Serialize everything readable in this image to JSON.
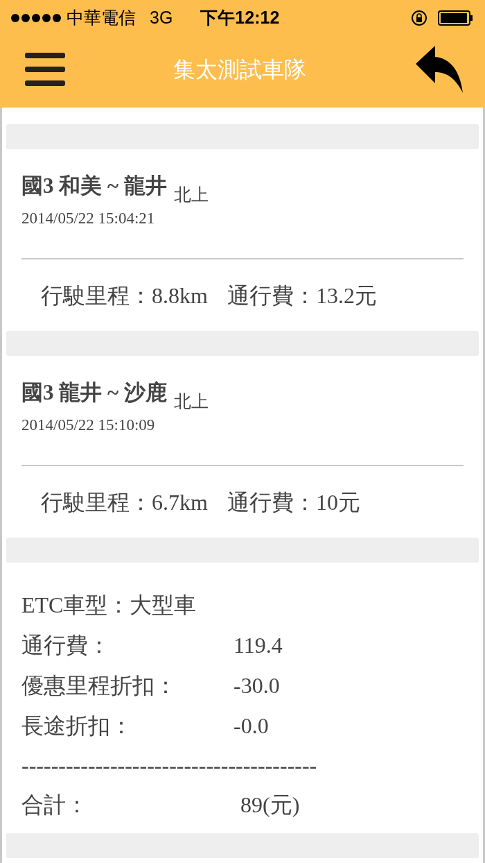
{
  "status_bar": {
    "carrier": "中華電信",
    "network": "3G",
    "time": "下午12:12"
  },
  "header": {
    "title": "集太測試車隊"
  },
  "trips": [
    {
      "title": "國3 和美 ~ 龍井",
      "direction": "北上",
      "datetime": "2014/05/22 15:04:21",
      "distance_label": "行駛里程：",
      "distance": "8.8km",
      "fee_label": "通行費：",
      "fee": "13.2元"
    },
    {
      "title": "國3 龍井 ~ 沙鹿",
      "direction": "北上",
      "datetime": "2014/05/22 15:10:09",
      "distance_label": "行駛里程：",
      "distance": "6.7km",
      "fee_label": "通行費：",
      "fee": "10元"
    }
  ],
  "summary": {
    "vehicle_type": "ETC車型：大型車",
    "rows": [
      {
        "label": "通行費：",
        "value": "119.4"
      },
      {
        "label": "優惠里程折扣：",
        "value": "-30.0"
      },
      {
        "label": "長途折扣：",
        "value": "-0.0"
      }
    ],
    "separator": "----------------------------------------",
    "total_label": "合計：",
    "total_value": "89(元)"
  }
}
